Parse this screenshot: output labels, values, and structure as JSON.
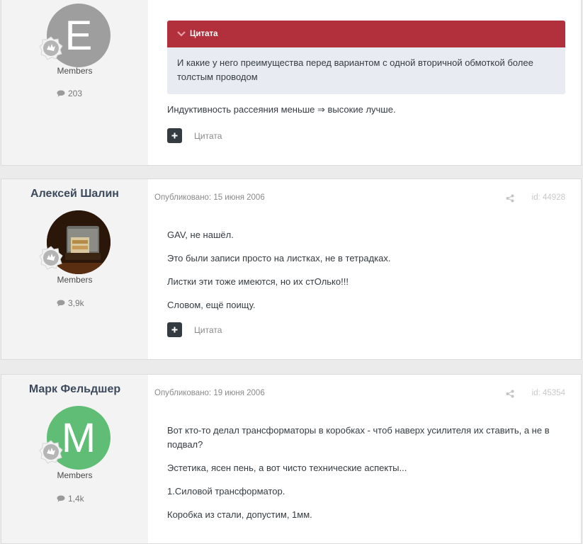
{
  "posts": [
    {
      "author": "",
      "avatar_letter": "E",
      "avatar_color": "#9e9e9e",
      "group": "Members",
      "post_count": "203",
      "quote": {
        "title": "Цитата",
        "text": "И какие у него преимущества перед вариантом с одной вторичной обмоткой более толстым проводом"
      },
      "paragraphs": [
        "Индуктивность рассеяния меньше ⇒ высокие лучше."
      ],
      "quote_label": "Цитата"
    },
    {
      "author": "Алексей Шалин",
      "avatar_letter": "",
      "avatar_color": "#4a2a14",
      "group": "Members",
      "post_count": "3,9k",
      "date": "Опубликовано: 15 июня 2006",
      "post_id": "id: 44928",
      "paragraphs": [
        "GAV, не нашёл.",
        "Это были записи просто на листках, не в тетрадках.",
        "Листки эти тоже имеются, но их стОлько!!!",
        "Словом, ещё поищу."
      ],
      "quote_label": "Цитата"
    },
    {
      "author": "Марк Фельдшер",
      "avatar_letter": "M",
      "avatar_color": "#5fbd75",
      "group": "Members",
      "post_count": "1,4k",
      "date": "Опубликовано: 19 июня 2006",
      "post_id": "id: 45354",
      "paragraphs": [
        "Вот кто-то делал трансформаторы в коробках - чтоб наверх усилителя их ставить, а не в подвал?",
        "Эстетика, ясен пень, а вот чисто технические аспекты...",
        "1.Силовой трансформатор.",
        "Коробка из стали, допустим, 1мм."
      ]
    }
  ],
  "icons": {
    "rank": "rank-badge-icon",
    "comment": "comment-icon",
    "share": "share-icon",
    "plus": "plus-icon",
    "chevron": "chevron-down-icon"
  }
}
